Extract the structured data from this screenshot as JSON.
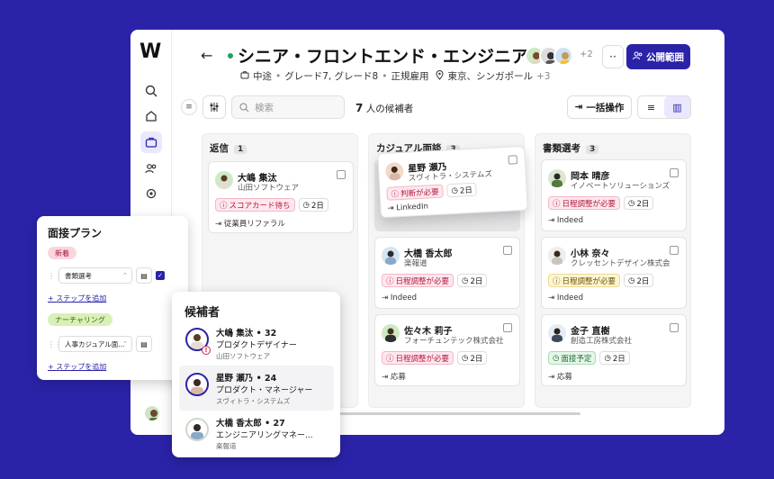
{
  "header": {
    "title": "シニア・フロントエンド・エンジニア",
    "meta_type": "中途",
    "meta_grade": "グレード7, グレード8",
    "meta_employment": "正規雇用",
    "meta_location": "東京、シンガポール",
    "meta_location_more": "+3",
    "hiring_team_more": "+2",
    "more_label": "··",
    "publish_label": "公開範囲"
  },
  "toolbar": {
    "search_placeholder": "検索",
    "count_number": "7",
    "count_label": "人の候補者",
    "bulk_label": "一括操作"
  },
  "columns": [
    {
      "title": "返信",
      "count": "1",
      "cards": [
        {
          "name": "大嶋 集汰",
          "company": "山田ソフトウェア",
          "tag": "スコアカード待ち",
          "days": "2日",
          "source": "従業員リファラル"
        }
      ]
    },
    {
      "title": "カジュアル面談",
      "count": "3",
      "cards": [
        {
          "name": "星野 瀬乃",
          "company": "スヴィトラ・システムズ",
          "tag": "判断が必要",
          "days": "2日",
          "source": "LinkedIn"
        },
        {
          "name": "大橋 香太郎",
          "company": "楽報道",
          "tag": "日程調整が必要",
          "days": "2日",
          "source": "Indeed"
        },
        {
          "name": "佐々木 莉子",
          "company": "フォーチュンテック株式会社",
          "tag": "日程調整が必要",
          "days": "2日",
          "source": "応募"
        }
      ]
    },
    {
      "title": "書類選考",
      "count": "3",
      "cards": [
        {
          "name": "岡本 晴彦",
          "company": "イノベートソリューションズ",
          "tag": "日程調整が必要",
          "days": "2日",
          "source": "Indeed"
        },
        {
          "name": "小林 奈々",
          "company": "クレッセントデザイン株式会社",
          "tag": "日程調整が必要",
          "days": "2日",
          "source": "Indeed"
        },
        {
          "name": "金子 直樹",
          "company": "創造工房株式会社",
          "tag": "面接予定",
          "days": "2日",
          "source": "応募"
        }
      ]
    }
  ],
  "plan": {
    "title": "面接プラン",
    "stage1": "新着",
    "stage1_select": "書類選考",
    "stage2": "ナーチャリング",
    "stage2_select": "人事カジュアル面...",
    "add_step": "ステップを追加"
  },
  "candidates": {
    "title": "候補者",
    "rows": [
      {
        "name": "大嶋 集汰",
        "age": "32",
        "role": "プロダクトデザイナー",
        "company": "山田ソフトウェア"
      },
      {
        "name": "星野 瀬乃",
        "age": "24",
        "role": "プロダクト・マネージャー",
        "company": "スヴィトラ・システムズ"
      },
      {
        "name": "大橋 香太郎",
        "age": "27",
        "role": "エンジニアリングマネー...",
        "company": "楽報道"
      }
    ]
  },
  "colors": {
    "brand": "#2a23a8",
    "live": "#1ea45b",
    "alert": "#b2183c"
  }
}
